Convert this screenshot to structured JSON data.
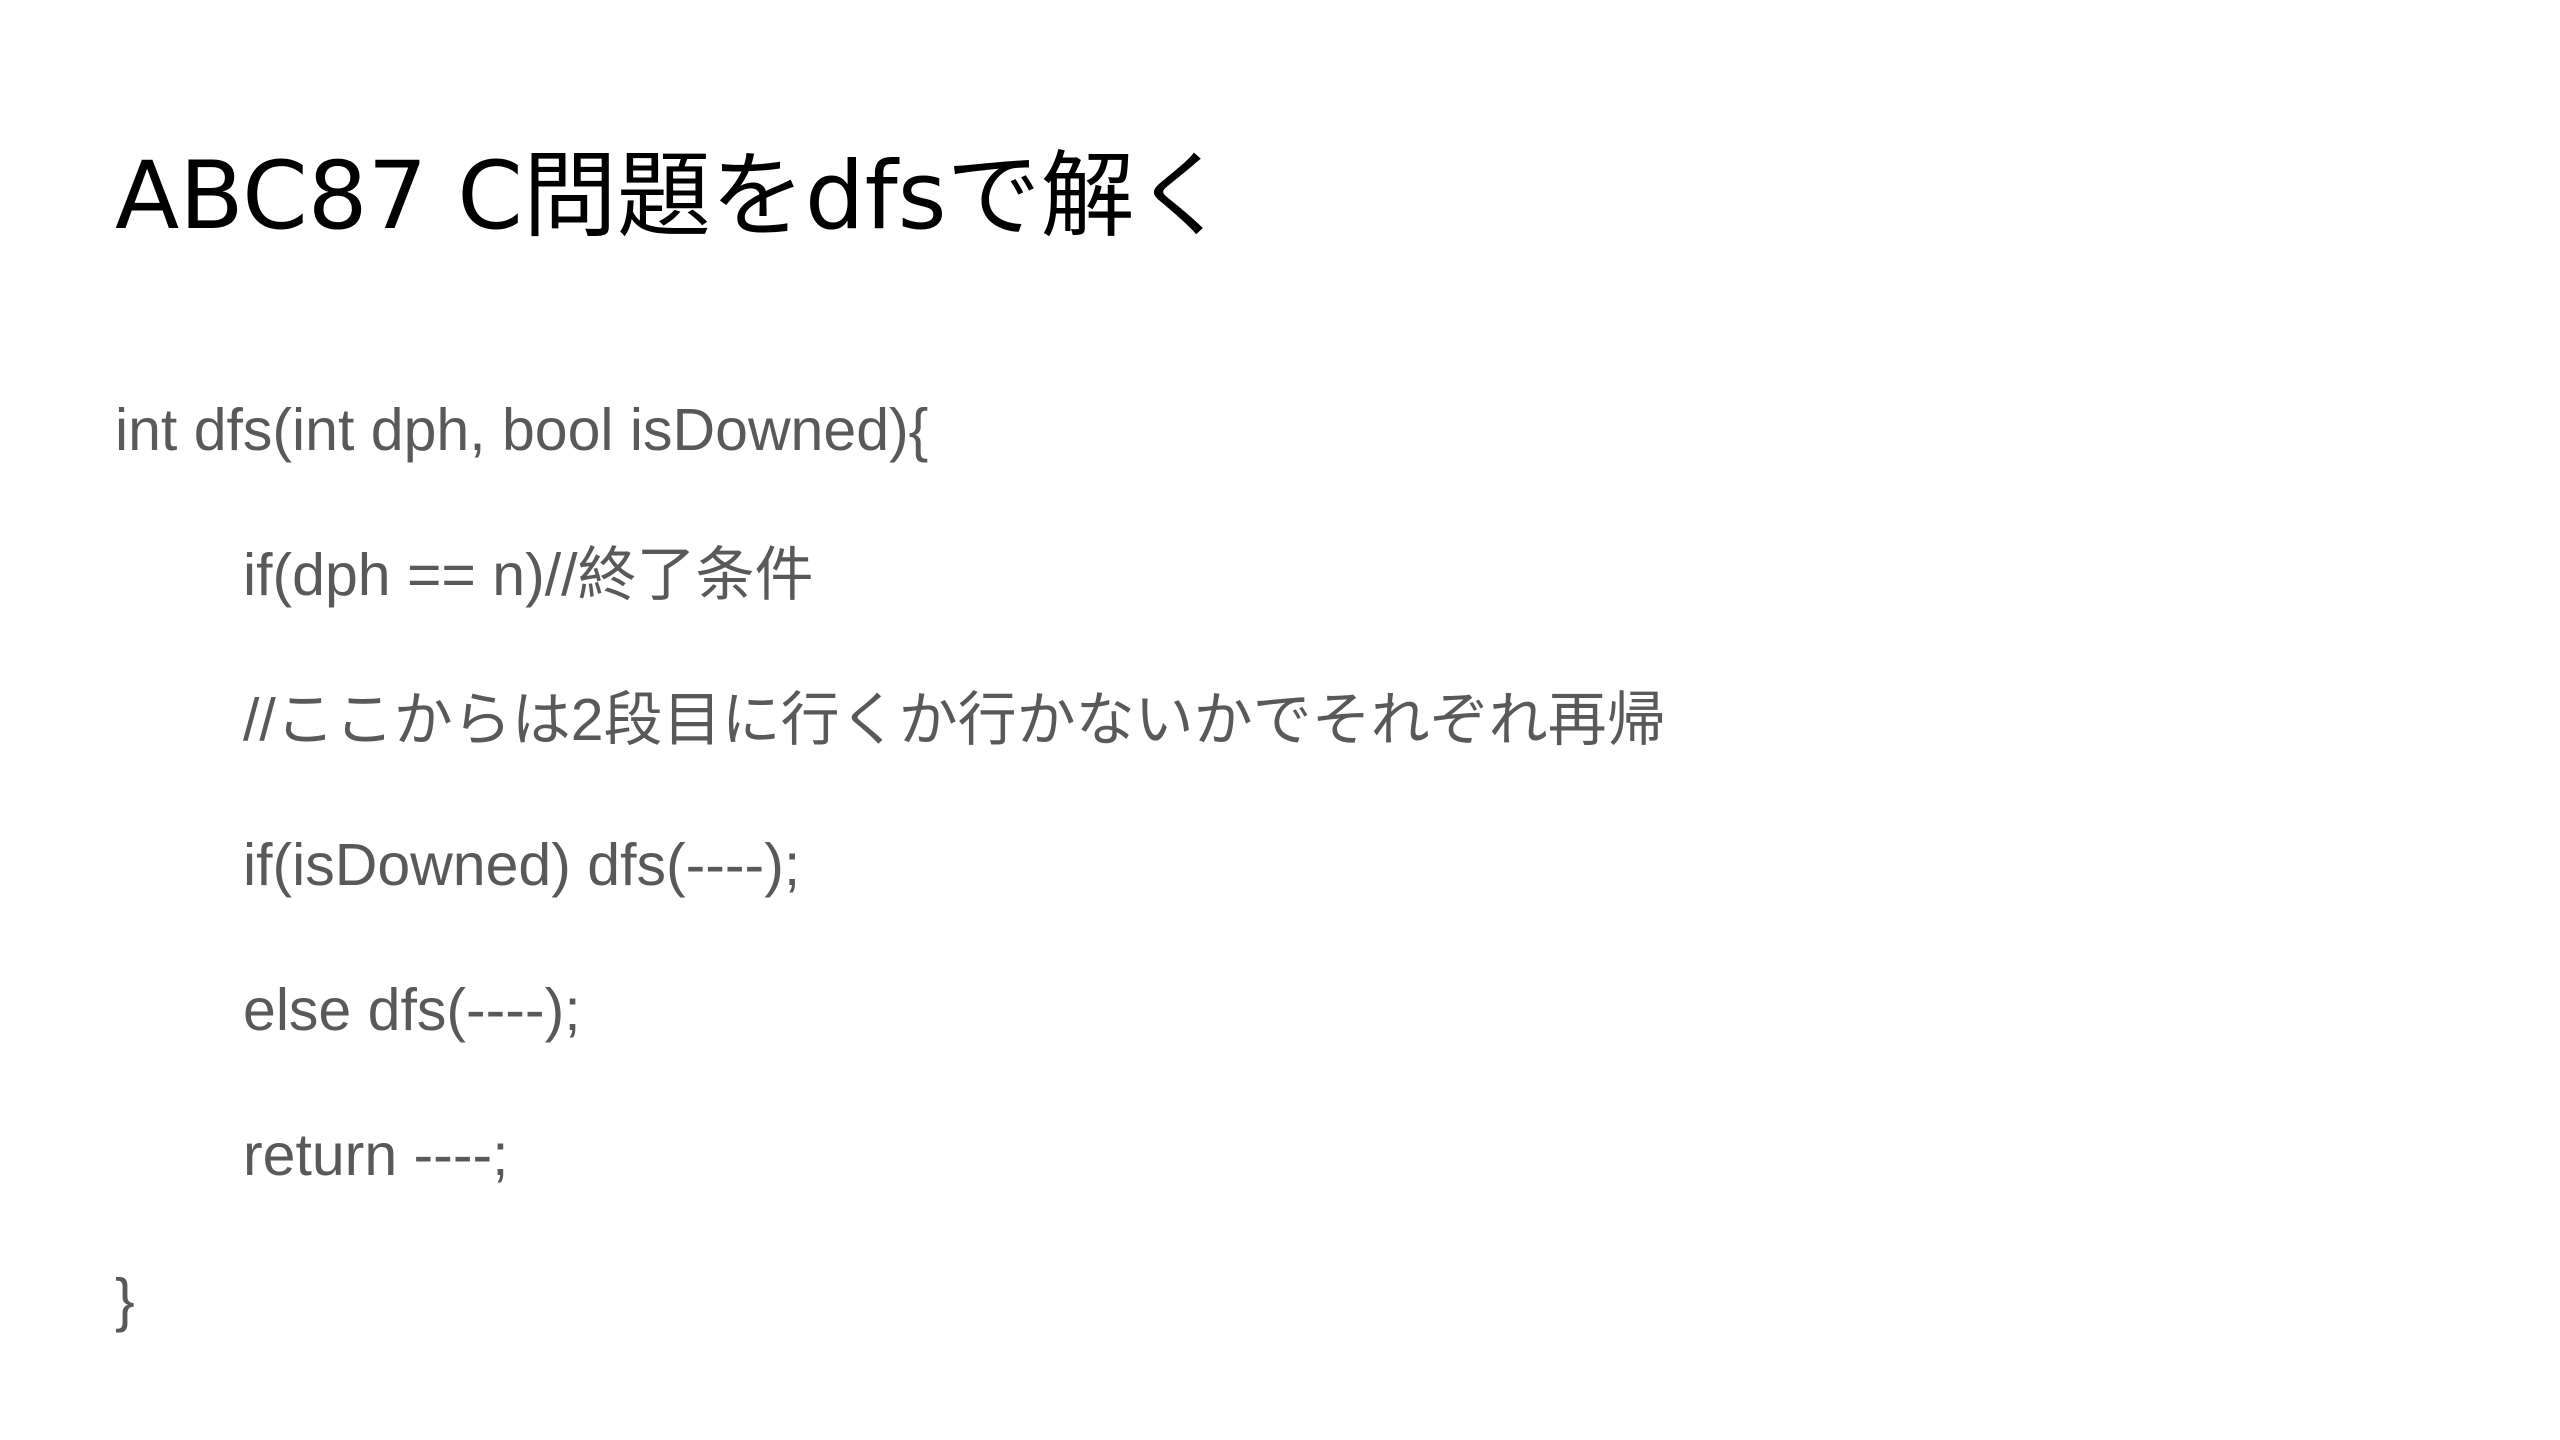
{
  "slide": {
    "title": "ABC87 C問題をdfsで解く",
    "code_lines": [
      "int dfs(int dph, bool isDowned){",
      "if(dph == n)//終了条件",
      "//ここからは2段目に行くか行かないかでそれぞれ再帰",
      "if(isDowned) dfs(----);",
      "else dfs(----);",
      "return ----;",
      "}"
    ]
  },
  "colors": {
    "background": "#ffffff",
    "title_text": "#000000",
    "body_text": "#595959"
  }
}
